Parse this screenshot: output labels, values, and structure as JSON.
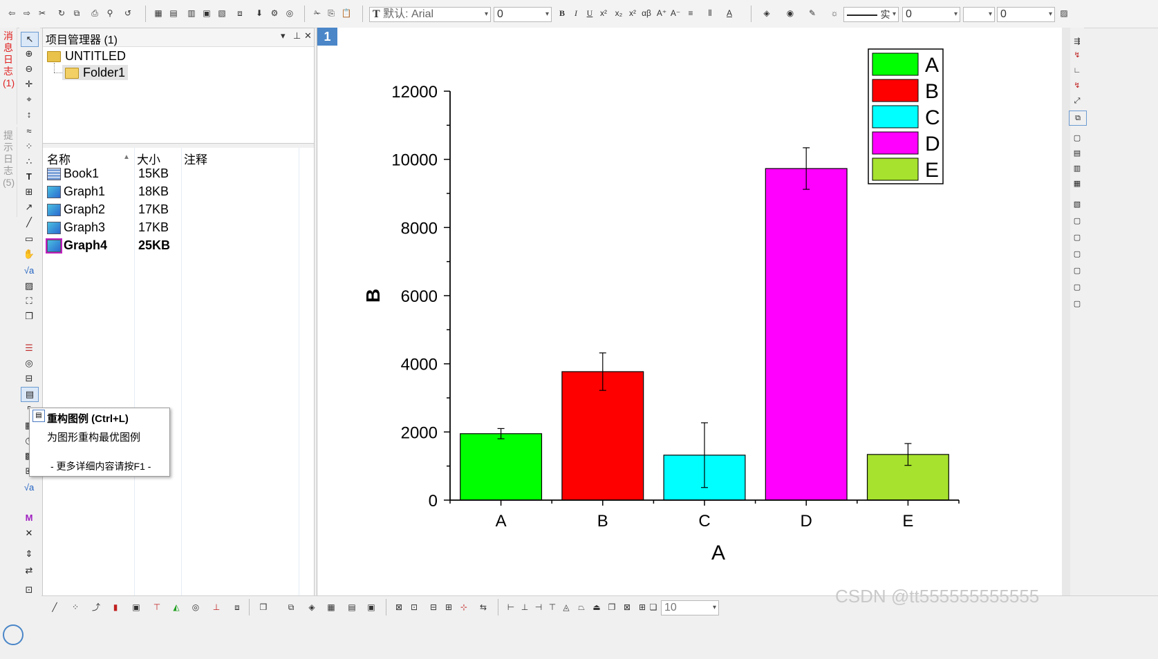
{
  "toolbar": {
    "font_label": "默认: Arial",
    "font_size": "0",
    "line_style": "实",
    "line_width": "0",
    "fill_value": "0",
    "bottom_zoom": "10"
  },
  "side_tabs": {
    "message_log": "消息日志 (1)",
    "hint_log": "提示日志 (5)"
  },
  "project_manager": {
    "title": "项目管理器 (1)",
    "tree": {
      "root": "UNTITLED",
      "folder": "Folder1"
    },
    "columns": {
      "name": "名称",
      "size": "大小",
      "note": "注释"
    },
    "rows": [
      {
        "name": "Book1",
        "size": "15KB",
        "icon": "book-icon"
      },
      {
        "name": "Graph1",
        "size": "18KB",
        "icon": "graph-icon"
      },
      {
        "name": "Graph2",
        "size": "17KB",
        "icon": "graph-icon"
      },
      {
        "name": "Graph3",
        "size": "17KB",
        "icon": "graph-icon"
      },
      {
        "name": "Graph4",
        "size": "25KB",
        "icon": "graph-icon"
      }
    ]
  },
  "tooltip": {
    "title": "重构图例 (Ctrl+L)",
    "description": "为图形重构最优图例",
    "more": "- 更多详细内容请按F1 -"
  },
  "graph_window": {
    "page_number": "1"
  },
  "watermark": "CSDN @tt555555555555",
  "chart_data": {
    "type": "bar",
    "xlabel": "A",
    "ylabel": "B",
    "categories": [
      "A",
      "B",
      "C",
      "D",
      "E"
    ],
    "values": [
      1950,
      3770,
      1320,
      9730,
      1340
    ],
    "errors": [
      150,
      550,
      950,
      610,
      320
    ],
    "colors": [
      "#00ff00",
      "#ff0000",
      "#00ffff",
      "#ff00ff",
      "#a6e22e"
    ],
    "ylim": [
      0,
      12000
    ],
    "yticks": [
      0,
      2000,
      4000,
      6000,
      8000,
      10000,
      12000
    ],
    "legend": [
      "A",
      "B",
      "C",
      "D",
      "E"
    ],
    "legend_position": "top-right",
    "grid": false
  }
}
